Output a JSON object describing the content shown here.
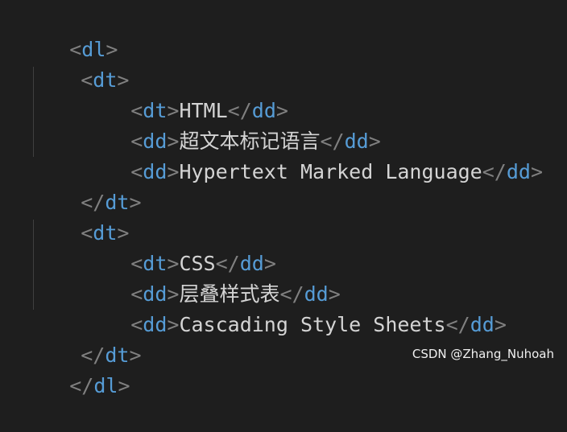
{
  "code": {
    "lines": [
      {
        "indent": 0,
        "open": "<",
        "tag": "dl",
        "close": ">",
        "text": "",
        "end_open": "",
        "end_tag": "",
        "end_close": ""
      },
      {
        "indent": 1,
        "open": "<",
        "tag": "dt",
        "close": ">",
        "text": "",
        "end_open": "",
        "end_tag": "",
        "end_close": ""
      },
      {
        "indent": 2,
        "open": "<",
        "tag": "dt",
        "close": ">",
        "text": "HTML",
        "end_open": "</",
        "end_tag": "dd",
        "end_close": ">"
      },
      {
        "indent": 2,
        "open": "<",
        "tag": "dd",
        "close": ">",
        "text": "超文本标记语言",
        "end_open": "</",
        "end_tag": "dd",
        "end_close": ">"
      },
      {
        "indent": 2,
        "open": "<",
        "tag": "dd",
        "close": ">",
        "text": "Hypertext Marked Language",
        "end_open": "</",
        "end_tag": "dd",
        "end_close": ">"
      },
      {
        "indent": 1,
        "open": "</",
        "tag": "dt",
        "close": ">",
        "text": "",
        "end_open": "",
        "end_tag": "",
        "end_close": ""
      },
      {
        "indent": 1,
        "open": "<",
        "tag": "dt",
        "close": ">",
        "text": "",
        "end_open": "",
        "end_tag": "",
        "end_close": ""
      },
      {
        "indent": 2,
        "open": "<",
        "tag": "dt",
        "close": ">",
        "text": "CSS",
        "end_open": "</",
        "end_tag": "dd",
        "end_close": ">"
      },
      {
        "indent": 2,
        "open": "<",
        "tag": "dd",
        "close": ">",
        "text": "层叠样式表",
        "end_open": "</",
        "end_tag": "dd",
        "end_close": ">"
      },
      {
        "indent": 2,
        "open": "<",
        "tag": "dd",
        "close": ">",
        "text": "Cascading Style Sheets",
        "end_open": "</",
        "end_tag": "dd",
        "end_close": ">"
      },
      {
        "indent": 1,
        "open": "</",
        "tag": "dt",
        "close": ">",
        "text": "",
        "end_open": "",
        "end_tag": "",
        "end_close": ""
      },
      {
        "indent": 0,
        "open": "</",
        "tag": "dl",
        "close": ">",
        "text": "",
        "end_open": "",
        "end_tag": "",
        "end_close": ""
      }
    ]
  },
  "watermark": "CSDN @Zhang_Nuhoah",
  "colors": {
    "background": "#1e1e1e",
    "tag": "#569cd6",
    "punctuation": "#808080",
    "text": "#d4d4d4"
  }
}
